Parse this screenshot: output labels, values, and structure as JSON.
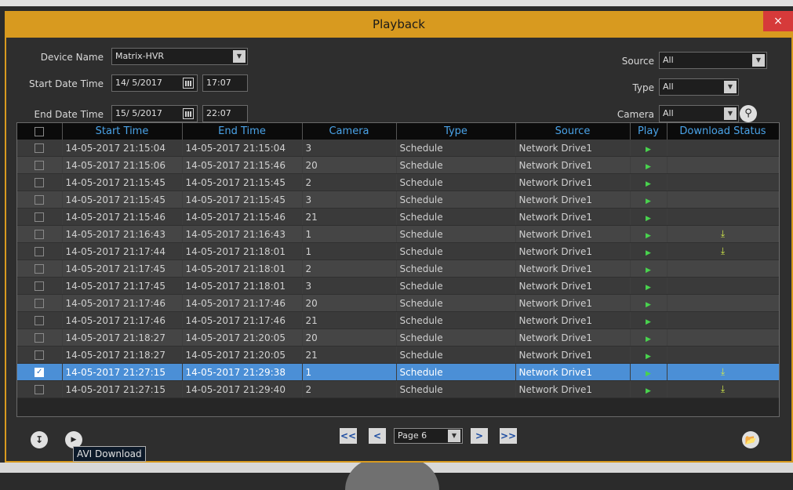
{
  "window": {
    "title": "Playback",
    "close_label": "×"
  },
  "filters": {
    "device_name_label": "Device Name",
    "device_name_value": "Matrix-HVR",
    "start_label": "Start Date Time",
    "start_date": "14/ 5/2017",
    "start_time": "17:07",
    "end_label": "End Date Time",
    "end_date": "15/ 5/2017",
    "end_time": "22:07",
    "source_label": "Source",
    "source_value": "All",
    "type_label": "Type",
    "type_value": "All",
    "camera_label": "Camera",
    "camera_value": "All"
  },
  "table": {
    "columns": [
      "",
      "Start Time",
      "End Time",
      "Camera",
      "Type",
      "Source",
      "Play",
      "Download Status"
    ],
    "rows": [
      {
        "start": "14-05-2017 21:15:04",
        "end": "14-05-2017 21:15:04",
        "camera": "3",
        "type": "Schedule",
        "source": "Network Drive1",
        "downloaded": false,
        "checked": false
      },
      {
        "start": "14-05-2017 21:15:06",
        "end": "14-05-2017 21:15:46",
        "camera": "20",
        "type": "Schedule",
        "source": "Network Drive1",
        "downloaded": false,
        "checked": false
      },
      {
        "start": "14-05-2017 21:15:45",
        "end": "14-05-2017 21:15:45",
        "camera": "2",
        "type": "Schedule",
        "source": "Network Drive1",
        "downloaded": false,
        "checked": false
      },
      {
        "start": "14-05-2017 21:15:45",
        "end": "14-05-2017 21:15:45",
        "camera": "3",
        "type": "Schedule",
        "source": "Network Drive1",
        "downloaded": false,
        "checked": false
      },
      {
        "start": "14-05-2017 21:15:46",
        "end": "14-05-2017 21:15:46",
        "camera": "21",
        "type": "Schedule",
        "source": "Network Drive1",
        "downloaded": false,
        "checked": false
      },
      {
        "start": "14-05-2017 21:16:43",
        "end": "14-05-2017 21:16:43",
        "camera": "1",
        "type": "Schedule",
        "source": "Network Drive1",
        "downloaded": true,
        "checked": false
      },
      {
        "start": "14-05-2017 21:17:44",
        "end": "14-05-2017 21:18:01",
        "camera": "1",
        "type": "Schedule",
        "source": "Network Drive1",
        "downloaded": true,
        "checked": false
      },
      {
        "start": "14-05-2017 21:17:45",
        "end": "14-05-2017 21:18:01",
        "camera": "2",
        "type": "Schedule",
        "source": "Network Drive1",
        "downloaded": false,
        "checked": false
      },
      {
        "start": "14-05-2017 21:17:45",
        "end": "14-05-2017 21:18:01",
        "camera": "3",
        "type": "Schedule",
        "source": "Network Drive1",
        "downloaded": false,
        "checked": false
      },
      {
        "start": "14-05-2017 21:17:46",
        "end": "14-05-2017 21:17:46",
        "camera": "20",
        "type": "Schedule",
        "source": "Network Drive1",
        "downloaded": false,
        "checked": false
      },
      {
        "start": "14-05-2017 21:17:46",
        "end": "14-05-2017 21:17:46",
        "camera": "21",
        "type": "Schedule",
        "source": "Network Drive1",
        "downloaded": false,
        "checked": false
      },
      {
        "start": "14-05-2017 21:18:27",
        "end": "14-05-2017 21:20:05",
        "camera": "20",
        "type": "Schedule",
        "source": "Network Drive1",
        "downloaded": false,
        "checked": false
      },
      {
        "start": "14-05-2017 21:18:27",
        "end": "14-05-2017 21:20:05",
        "camera": "21",
        "type": "Schedule",
        "source": "Network Drive1",
        "downloaded": false,
        "checked": false
      },
      {
        "start": "14-05-2017 21:27:15",
        "end": "14-05-2017 21:29:38",
        "camera": "1",
        "type": "Schedule",
        "source": "Network Drive1",
        "downloaded": true,
        "checked": true
      },
      {
        "start": "14-05-2017 21:27:15",
        "end": "14-05-2017 21:29:40",
        "camera": "2",
        "type": "Schedule",
        "source": "Network Drive1",
        "downloaded": true,
        "checked": false
      }
    ]
  },
  "pager": {
    "first_label": "<<",
    "prev_label": "<",
    "page_value": "Page 6",
    "next_label": ">",
    "last_label": ">>"
  },
  "tooltip": {
    "text": "AVI Download"
  },
  "colors": {
    "accent": "#d89a1f",
    "header_text": "#4aa3e8",
    "selection": "#4b8fd6",
    "play": "#49d34e"
  }
}
